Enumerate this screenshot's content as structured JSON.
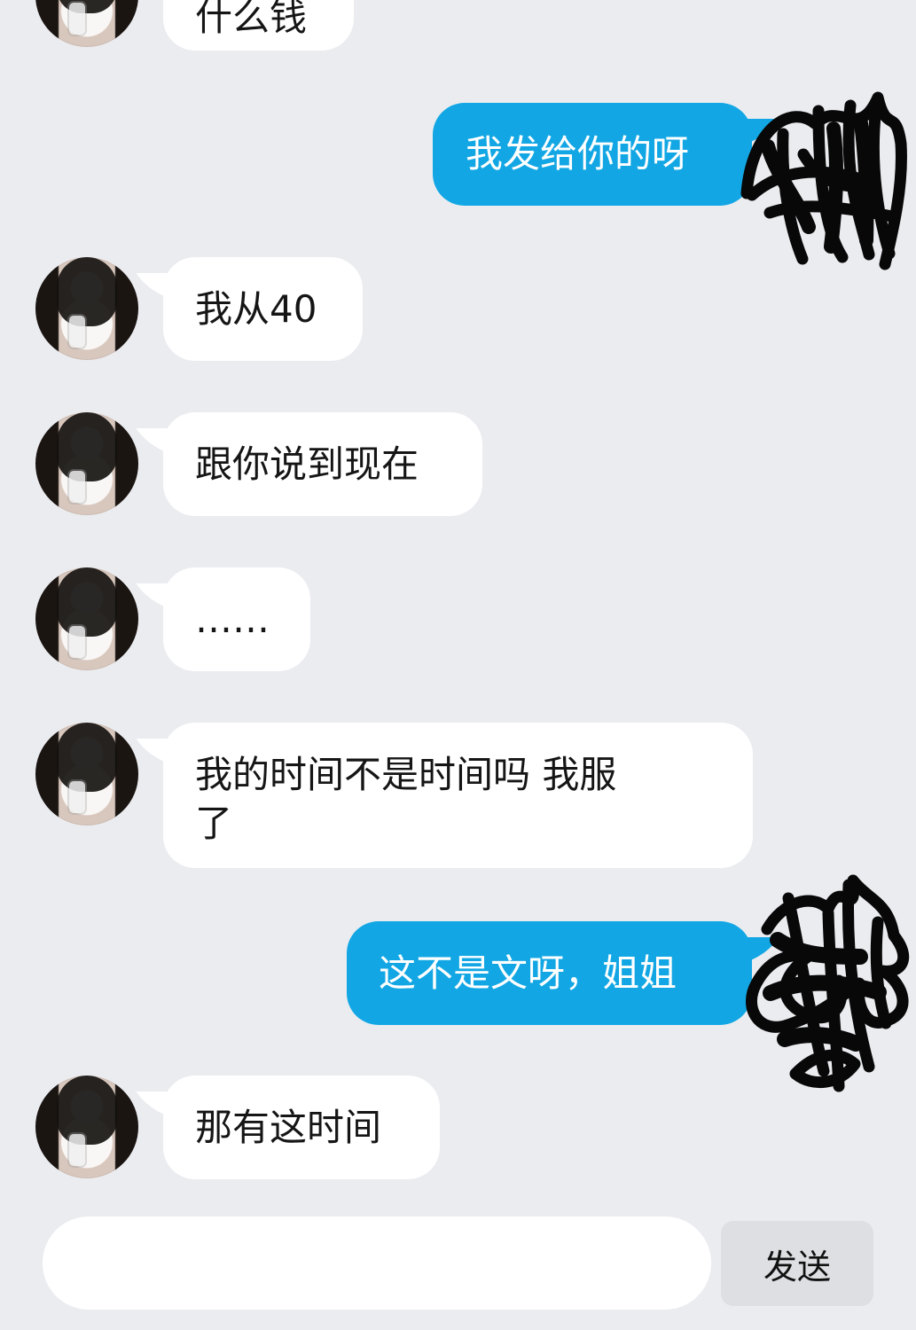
{
  "messages": [
    {
      "text": "什么钱"
    },
    {
      "text": "我发给你的呀"
    },
    {
      "text": "我从40"
    },
    {
      "text": "跟你说到现在"
    },
    {
      "text": "……"
    },
    {
      "text": "我的时间不是时间吗 我服"
    },
    {
      "text": "了"
    },
    {
      "text": "这不是文呀，姐姐"
    },
    {
      "text": "那有这时间"
    }
  ],
  "composer": {
    "placeholder": "",
    "send_label": "发送"
  },
  "colors": {
    "background": "#ebecf0",
    "incoming": "#ffffff",
    "outgoing": "#12a7e4",
    "send_button": "#dedfe3"
  }
}
